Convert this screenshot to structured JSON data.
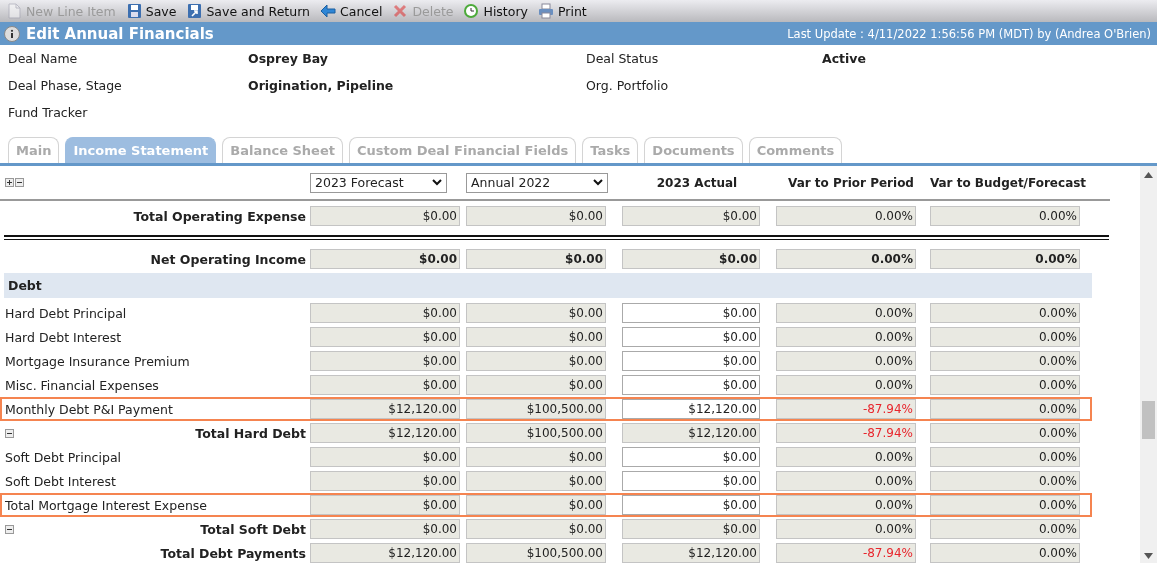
{
  "toolbar": [
    {
      "label": "New Line Item",
      "disabled": true
    },
    {
      "label": "Save",
      "disabled": false
    },
    {
      "label": "Save and Return",
      "disabled": false
    },
    {
      "label": "Cancel",
      "disabled": false
    },
    {
      "label": "Delete",
      "disabled": true
    },
    {
      "label": "History",
      "disabled": false
    },
    {
      "label": "Print",
      "disabled": false
    }
  ],
  "title_bar": {
    "title": "Edit Annual Financials",
    "last_update": "Last Update : 4/11/2022 1:56:56 PM (MDT) by (Andrea O'Brien)"
  },
  "deal_fields": [
    {
      "label": "Deal Name",
      "value": "Osprey Bay"
    },
    {
      "label": "Deal Status",
      "value": "Active"
    },
    {
      "label": "Deal Phase, Stage",
      "value": "Origination, Pipeline"
    },
    {
      "label": "Org. Portfolio"
    },
    {
      "label": "Fund Tracker"
    }
  ],
  "tabs": [
    {
      "label": "Main",
      "selected": false
    },
    {
      "label": "Income Statement",
      "selected": true
    },
    {
      "label": "Balance Sheet",
      "selected": false
    },
    {
      "label": "Custom Deal Financial Fields",
      "selected": false
    },
    {
      "label": "Tasks",
      "selected": false
    },
    {
      "label": "Documents",
      "selected": false
    },
    {
      "label": "Comments",
      "selected": false
    }
  ],
  "table": {
    "period_selects": [
      "2023 Forecast",
      "Annual 2022"
    ],
    "columns": [
      "2023 Actual",
      "Var to Prior Period",
      "Var to Budget/Forecast"
    ],
    "rows": [
      {
        "kind": "total",
        "label": "Total Operating Expense",
        "values": [
          "$0.00",
          "$0.00",
          "$0.00",
          "0.00%",
          "0.00%"
        ],
        "rule_after": true
      },
      {
        "kind": "total",
        "label": "Net Operating Income",
        "values": [
          "$0.00",
          "$0.00",
          "$0.00",
          "0.00%",
          "0.00%"
        ],
        "bold_values": true
      },
      {
        "kind": "section",
        "label": "Debt"
      },
      {
        "kind": "item",
        "label": "Hard Debt Principal",
        "values": [
          "$0.00",
          "$0.00",
          "$0.00",
          "0.00%",
          "0.00%"
        ]
      },
      {
        "kind": "item",
        "label": "Hard Debt Interest",
        "values": [
          "$0.00",
          "$0.00",
          "$0.00",
          "0.00%",
          "0.00%"
        ]
      },
      {
        "kind": "item",
        "label": "Mortgage Insurance Premium",
        "values": [
          "$0.00",
          "$0.00",
          "$0.00",
          "0.00%",
          "0.00%"
        ]
      },
      {
        "kind": "item",
        "label": "Misc. Financial Expenses",
        "values": [
          "$0.00",
          "$0.00",
          "$0.00",
          "0.00%",
          "0.00%"
        ]
      },
      {
        "kind": "item",
        "label": "Monthly Debt P&I Payment",
        "values": [
          "$12,120.00",
          "$100,500.00",
          "$12,120.00",
          "-87.94%",
          "0.00%"
        ],
        "highlighted": true,
        "prior_negative": true
      },
      {
        "kind": "total",
        "label": "Total Hard Debt",
        "values": [
          "$12,120.00",
          "$100,500.00",
          "$12,120.00",
          "-87.94%",
          "0.00%"
        ],
        "expanded": true,
        "prior_negative": true
      },
      {
        "kind": "item",
        "label": "Soft Debt Principal",
        "values": [
          "$0.00",
          "$0.00",
          "$0.00",
          "0.00%",
          "0.00%"
        ]
      },
      {
        "kind": "item",
        "label": "Soft Debt Interest",
        "values": [
          "$0.00",
          "$0.00",
          "$0.00",
          "0.00%",
          "0.00%"
        ]
      },
      {
        "kind": "item",
        "label": "Total Mortgage Interest Expense",
        "values": [
          "$0.00",
          "$0.00",
          "$0.00",
          "0.00%",
          "0.00%"
        ],
        "highlighted": true
      },
      {
        "kind": "total",
        "label": "Total Soft Debt",
        "values": [
          "$0.00",
          "$0.00",
          "$0.00",
          "0.00%",
          "0.00%"
        ],
        "expanded": true
      },
      {
        "kind": "total",
        "label": "Total Debt Payments",
        "values": [
          "$12,120.00",
          "$100,500.00",
          "$12,120.00",
          "-87.94%",
          "0.00%"
        ],
        "prior_negative": true
      }
    ]
  }
}
